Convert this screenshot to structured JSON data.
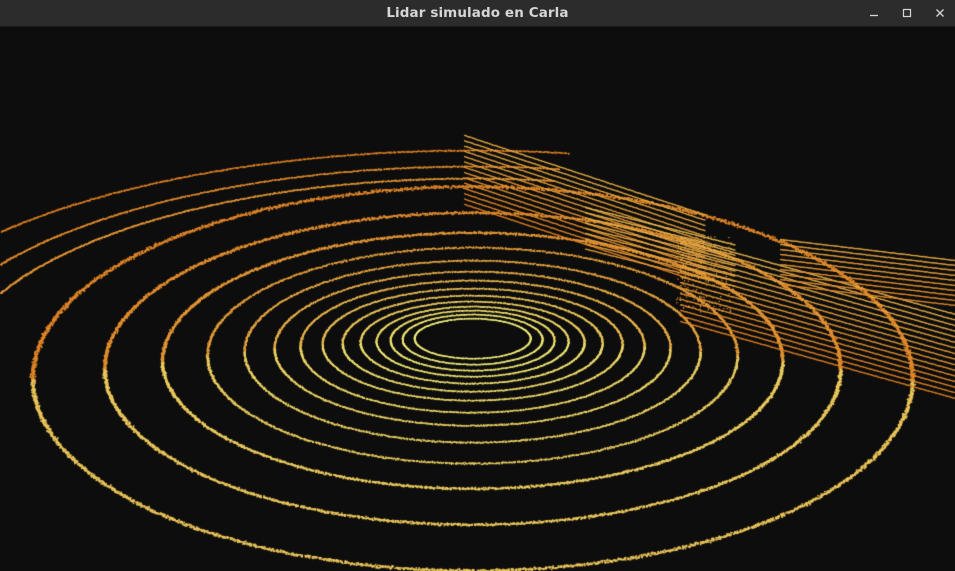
{
  "window": {
    "title": "Lidar simulado en Carla",
    "buttons": {
      "minimize_icon": "minimize-icon",
      "maximize_icon": "maximize-icon",
      "close_icon": "close-icon"
    }
  },
  "visualization": {
    "background": "#0d0d0d",
    "near_color": "#f3ef7a",
    "far_color": "#e07a1e"
  }
}
